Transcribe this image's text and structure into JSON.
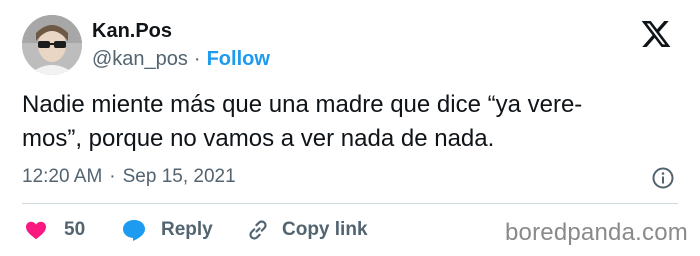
{
  "author": {
    "name": "Kan.Pos",
    "handle": "@kan_pos",
    "separator": "·",
    "follow_label": "Follow"
  },
  "tweet": {
    "line1": "Nadie miente más que una madre que dice “ya vere-",
    "line2": "mos”, porque no vamos a ver nada de nada."
  },
  "meta": {
    "time": "12:20 AM",
    "separator": "·",
    "date": "Sep 15, 2021"
  },
  "actions": {
    "like_count": "50",
    "reply_label": "Reply",
    "copy_link_label": "Copy link"
  },
  "watermark": "boredpanda.com",
  "icons": {
    "platform": "x-logo-icon",
    "info": "info-icon",
    "like": "heart-icon",
    "reply": "speech-bubble-icon",
    "copy": "link-icon"
  },
  "colors": {
    "text": "#0f1419",
    "secondary": "#536471",
    "accent": "#1d9bf0",
    "like": "#f91880",
    "divider": "#cfd9de"
  }
}
